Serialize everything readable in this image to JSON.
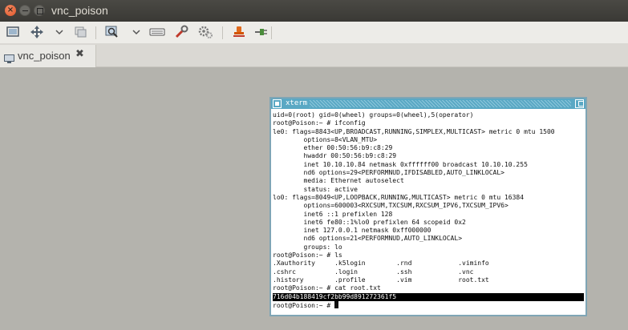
{
  "window": {
    "title": "vnc_poison"
  },
  "toolbar": {
    "buttons": [
      {
        "name": "screenshot-icon"
      },
      {
        "name": "move-icon"
      },
      {
        "name": "chevron-down-icon"
      },
      {
        "name": "copy-icon"
      },
      {
        "name": "zoom-icon"
      },
      {
        "name": "chevron-down-icon"
      },
      {
        "name": "keyboard-icon"
      },
      {
        "name": "wrench-icon"
      },
      {
        "name": "settings-icon"
      },
      {
        "name": "pin-icon"
      },
      {
        "name": "plug-icon"
      }
    ]
  },
  "tab": {
    "label": "vnc_poison",
    "close_glyph": "✖"
  },
  "xterm": {
    "title": "xterm",
    "lines": [
      "uid=0(root) gid=0(wheel) groups=0(wheel),5(operator)",
      "root@Poison:~ # ifconfig",
      "le0: flags=8843<UP,BROADCAST,RUNNING,SIMPLEX,MULTICAST> metric 0 mtu 1500",
      "        options=8<VLAN_MTU>",
      "        ether 00:50:56:b9:c8:29",
      "        hwaddr 00:50:56:b9:c8:29",
      "        inet 10.10.10.84 netmask 0xffffff00 broadcast 10.10.10.255",
      "        nd6 options=29<PERFORMNUD,IFDISABLED,AUTO_LINKLOCAL>",
      "        media: Ethernet autoselect",
      "        status: active",
      "lo0: flags=8049<UP,LOOPBACK,RUNNING,MULTICAST> metric 0 mtu 16384",
      "        options=600003<RXCSUM,TXCSUM,RXCSUM_IPV6,TXCSUM_IPV6>",
      "        inet6 ::1 prefixlen 128",
      "        inet6 fe80::1%lo0 prefixlen 64 scopeid 0x2",
      "        inet 127.0.0.1 netmask 0xff000000",
      "        nd6 options=21<PERFORMNUD,AUTO_LINKLOCAL>",
      "        groups: lo",
      "root@Poison:~ # ls",
      ".Xauthority     .k5login        .rnd            .viminfo",
      ".cshrc          .login          .ssh            .vnc",
      ".history        .profile        .vim            root.txt",
      "root@Poison:~ # cat root.txt",
      "716d04b188419cf2bb99d891272361f5",
      "root@Poison:~ # "
    ],
    "highlight_line": 22
  },
  "colors": {
    "desktop": "#b4b3ad",
    "xterm_title": "#5aa8c4",
    "close_button": "#e05428"
  }
}
